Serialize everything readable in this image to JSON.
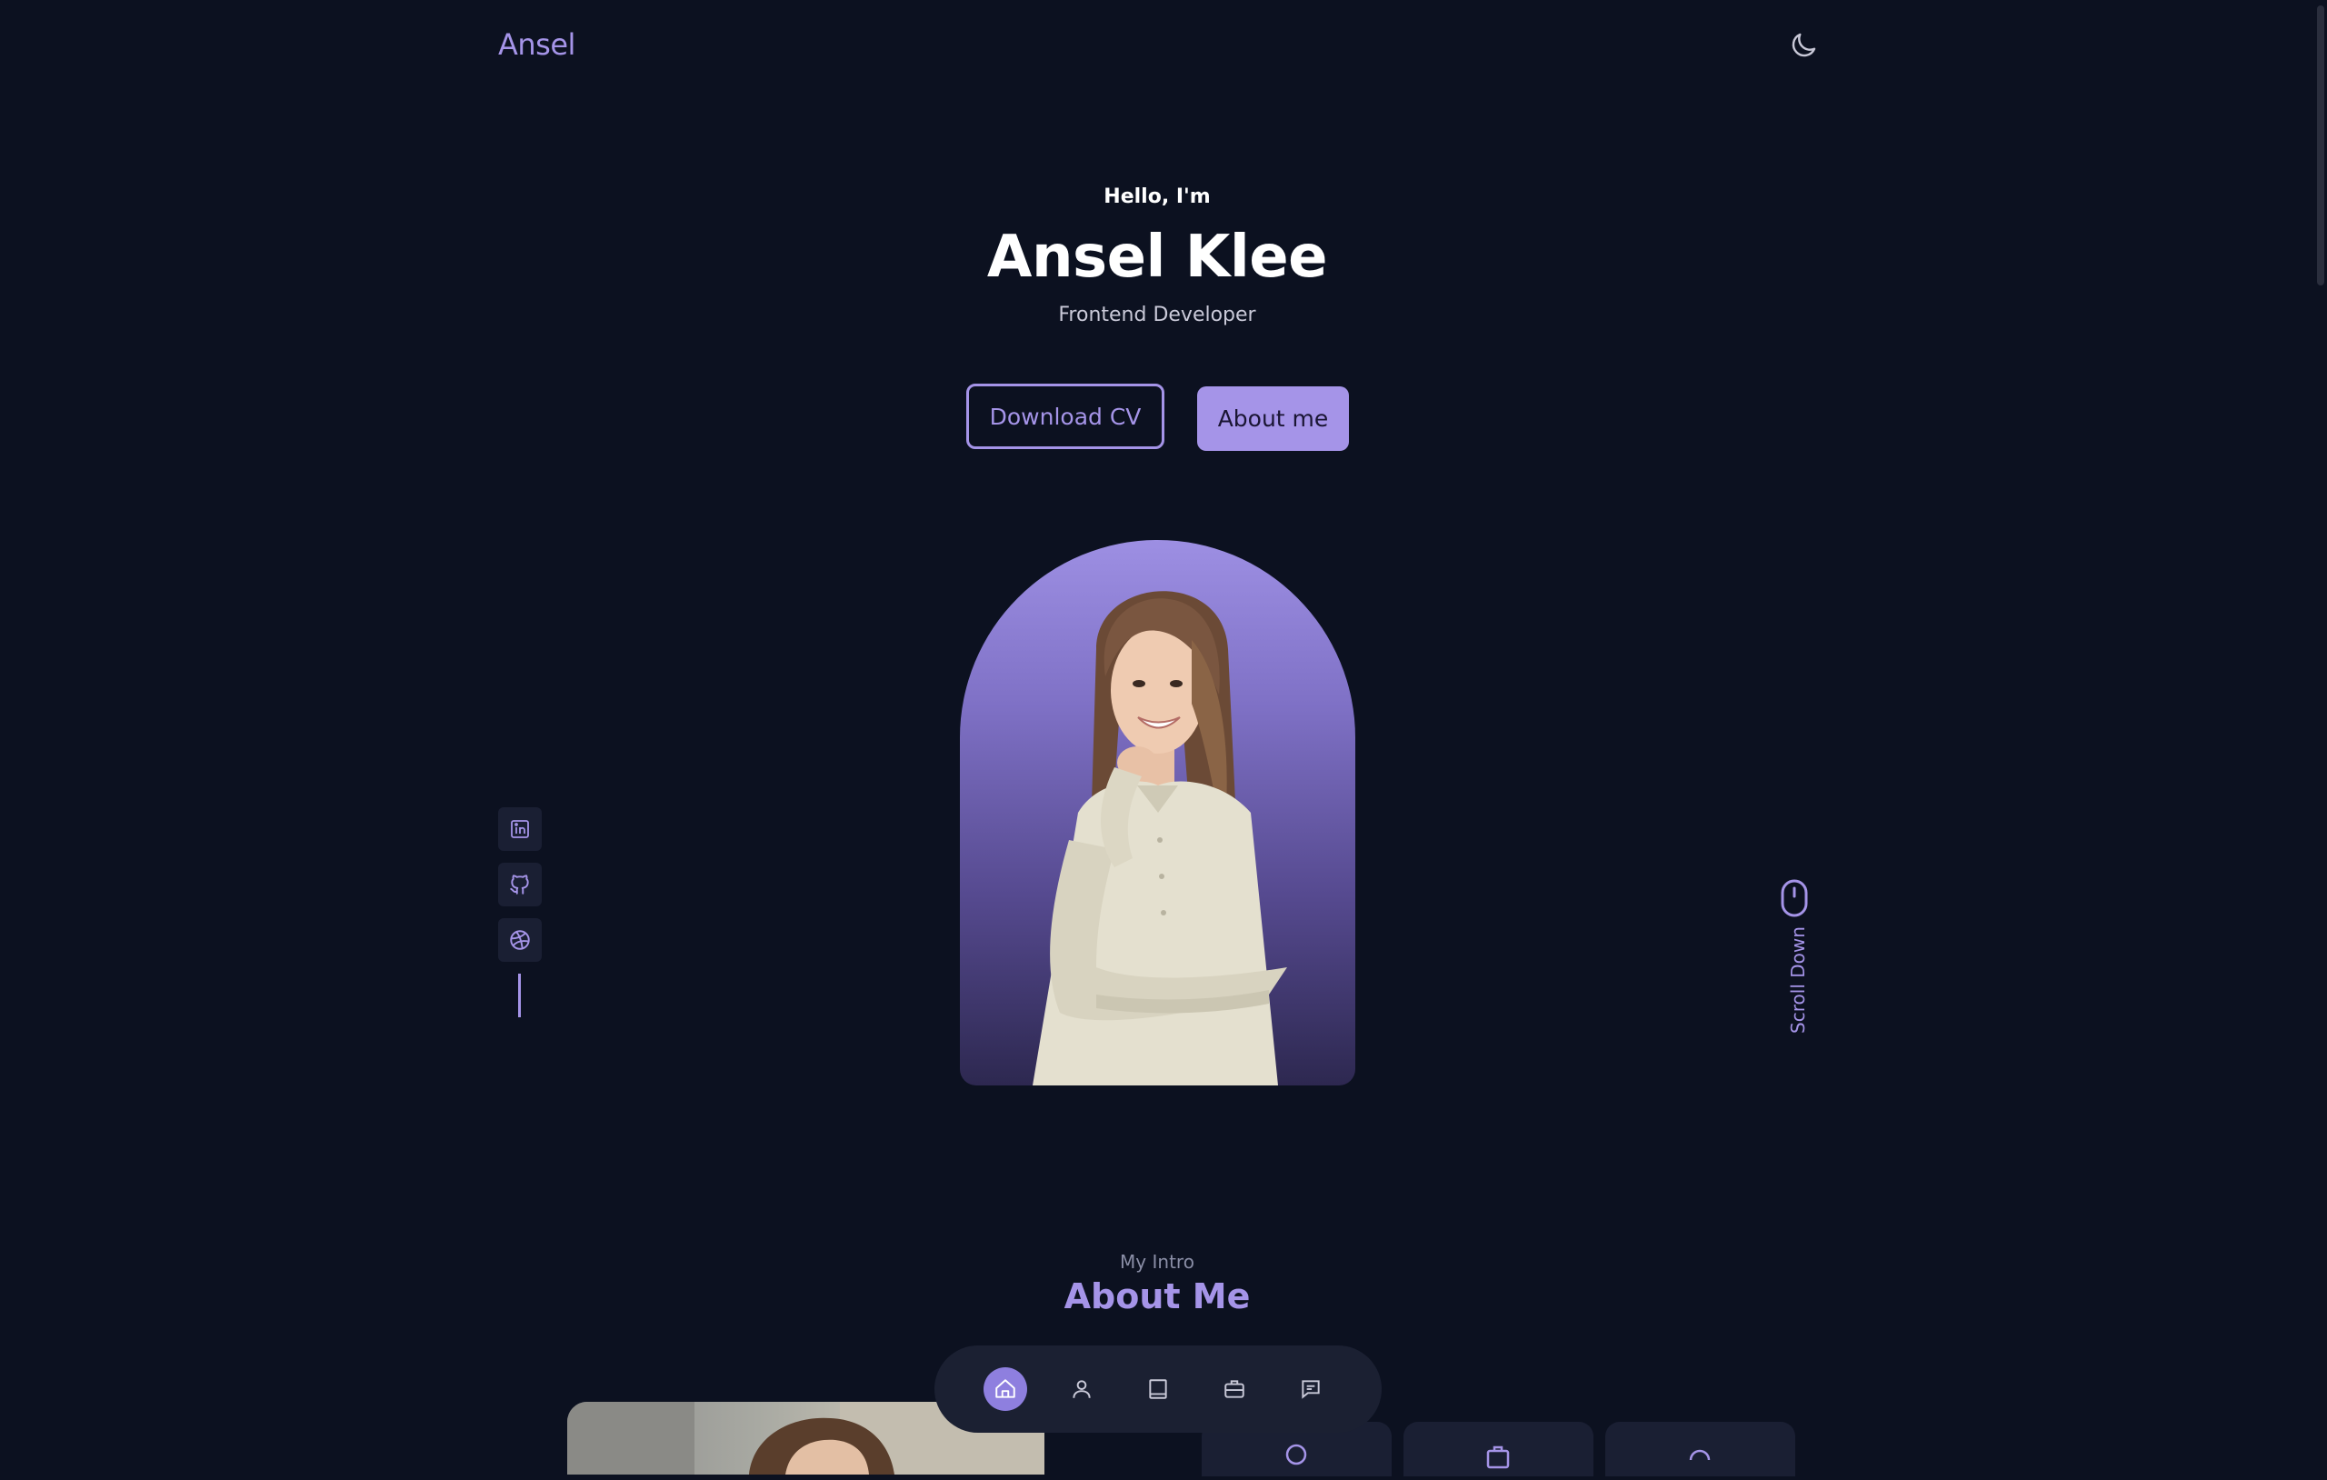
{
  "header": {
    "logo": "Ansel",
    "theme_toggle_icon": "moon-icon"
  },
  "hero": {
    "greeting": "Hello, I'm",
    "name": "Ansel Klee",
    "role": "Frontend Developer",
    "download_cv_label": "Download CV",
    "about_me_label": "About me"
  },
  "social": [
    {
      "icon": "linkedin-icon"
    },
    {
      "icon": "github-icon"
    },
    {
      "icon": "dribbble-icon"
    }
  ],
  "scroll": {
    "label": "Scroll Down",
    "icon": "mouse-icon"
  },
  "about": {
    "subtitle": "My Intro",
    "title": "About Me"
  },
  "bottom_nav": {
    "items": [
      {
        "icon": "home-icon",
        "active": true
      },
      {
        "icon": "user-icon",
        "active": false
      },
      {
        "icon": "book-icon",
        "active": false
      },
      {
        "icon": "briefcase-icon",
        "active": false
      },
      {
        "icon": "message-icon",
        "active": false
      }
    ]
  },
  "colors": {
    "background": "#0c1120",
    "accent": "#a594e8",
    "surface": "#1a1f33",
    "text": "#ffffff",
    "muted": "#8a8ea6"
  }
}
